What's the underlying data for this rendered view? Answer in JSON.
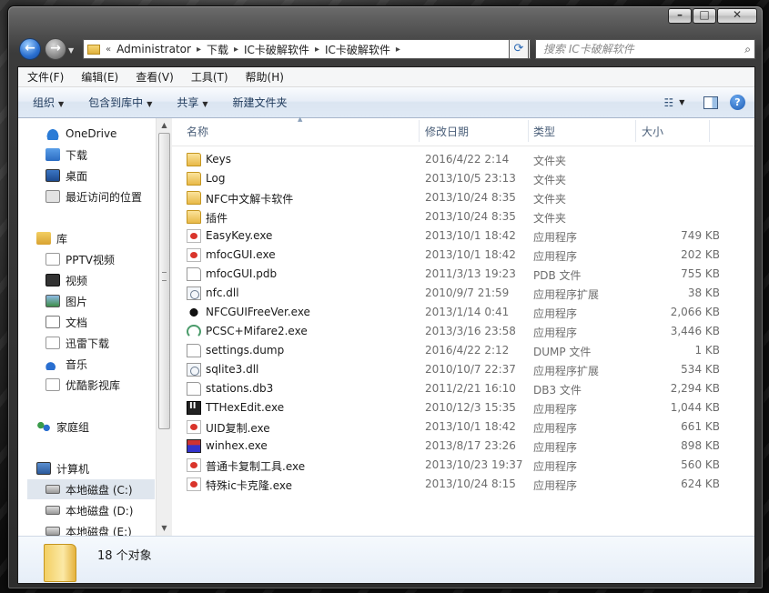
{
  "window": {
    "caption_buttons": {
      "minimize": "–",
      "maximize": "□",
      "close": "✕"
    }
  },
  "address": {
    "overflow": "«",
    "crumbs": [
      "Administrator",
      "下载",
      "IC卡破解软件",
      "IC卡破解软件"
    ]
  },
  "search": {
    "placeholder": "搜索 IC卡破解软件"
  },
  "menu": [
    "文件(F)",
    "编辑(E)",
    "查看(V)",
    "工具(T)",
    "帮助(H)"
  ],
  "toolbar": {
    "organize": "组织",
    "include_in_library": "包含到库中",
    "share": "共享",
    "new_folder": "新建文件夹"
  },
  "nav": {
    "favorites": [
      "OneDrive",
      "下载",
      "桌面",
      "最近访问的位置"
    ],
    "library": {
      "label": "库",
      "items": [
        "PPTV视频",
        "视频",
        "图片",
        "文档",
        "迅雷下载",
        "音乐",
        "优酷影视库"
      ]
    },
    "homegroup": "家庭组",
    "computer": {
      "label": "计算机",
      "items": [
        "本地磁盘 (C:)",
        "本地磁盘 (D:)",
        "本地磁盘 (E:)"
      ]
    }
  },
  "columns": {
    "name": "名称",
    "date": "修改日期",
    "type": "类型",
    "size": "大小"
  },
  "files": [
    {
      "name": "Keys",
      "date": "2016/4/22 2:14",
      "type": "文件夹",
      "size": "",
      "icon": "folder-icon"
    },
    {
      "name": "Log",
      "date": "2013/10/5 23:13",
      "type": "文件夹",
      "size": "",
      "icon": "folder-icon"
    },
    {
      "name": "NFC中文解卡软件",
      "date": "2013/10/24 8:35",
      "type": "文件夹",
      "size": "",
      "icon": "folder-icon"
    },
    {
      "name": "插件",
      "date": "2013/10/24 8:35",
      "type": "文件夹",
      "size": "",
      "icon": "folder-icon"
    },
    {
      "name": "EasyKey.exe",
      "date": "2013/10/1 18:42",
      "type": "应用程序",
      "size": "749 KB",
      "icon": "exe-icon"
    },
    {
      "name": "mfocGUI.exe",
      "date": "2013/10/1 18:42",
      "type": "应用程序",
      "size": "202 KB",
      "icon": "exe-icon"
    },
    {
      "name": "mfocGUI.pdb",
      "date": "2011/3/13 19:23",
      "type": "PDB 文件",
      "size": "755 KB",
      "icon": "document-icon"
    },
    {
      "name": "nfc.dll",
      "date": "2010/9/7 21:59",
      "type": "应用程序扩展",
      "size": "38 KB",
      "icon": "dll-icon"
    },
    {
      "name": "NFCGUIFreeVer.exe",
      "date": "2013/1/14 0:41",
      "type": "应用程序",
      "size": "2,066 KB",
      "icon": "bug-icon"
    },
    {
      "name": "PCSC+Mifare2.exe",
      "date": "2013/3/16 23:58",
      "type": "应用程序",
      "size": "3,446 KB",
      "icon": "wifi-icon"
    },
    {
      "name": "settings.dump",
      "date": "2016/4/22 2:12",
      "type": "DUMP 文件",
      "size": "1 KB",
      "icon": "document-icon"
    },
    {
      "name": "sqlite3.dll",
      "date": "2010/10/7 22:37",
      "type": "应用程序扩展",
      "size": "534 KB",
      "icon": "dll-icon"
    },
    {
      "name": "stations.db3",
      "date": "2011/2/21 16:10",
      "type": "DB3 文件",
      "size": "2,294 KB",
      "icon": "document-icon"
    },
    {
      "name": "TTHexEdit.exe",
      "date": "2010/12/3 15:35",
      "type": "应用程序",
      "size": "1,044 KB",
      "icon": "tthex-icon"
    },
    {
      "name": "UID复制.exe",
      "date": "2013/10/1 18:42",
      "type": "应用程序",
      "size": "661 KB",
      "icon": "exe-icon"
    },
    {
      "name": "winhex.exe",
      "date": "2013/8/17 23:26",
      "type": "应用程序",
      "size": "898 KB",
      "icon": "hex-icon"
    },
    {
      "name": "普通卡复制工具.exe",
      "date": "2013/10/23 19:37",
      "type": "应用程序",
      "size": "560 KB",
      "icon": "exe-icon"
    },
    {
      "name": "特殊ic卡克隆.exe",
      "date": "2013/10/24 8:15",
      "type": "应用程序",
      "size": "624 KB",
      "icon": "exe-icon"
    }
  ],
  "status": {
    "item_count": "18 个对象"
  }
}
